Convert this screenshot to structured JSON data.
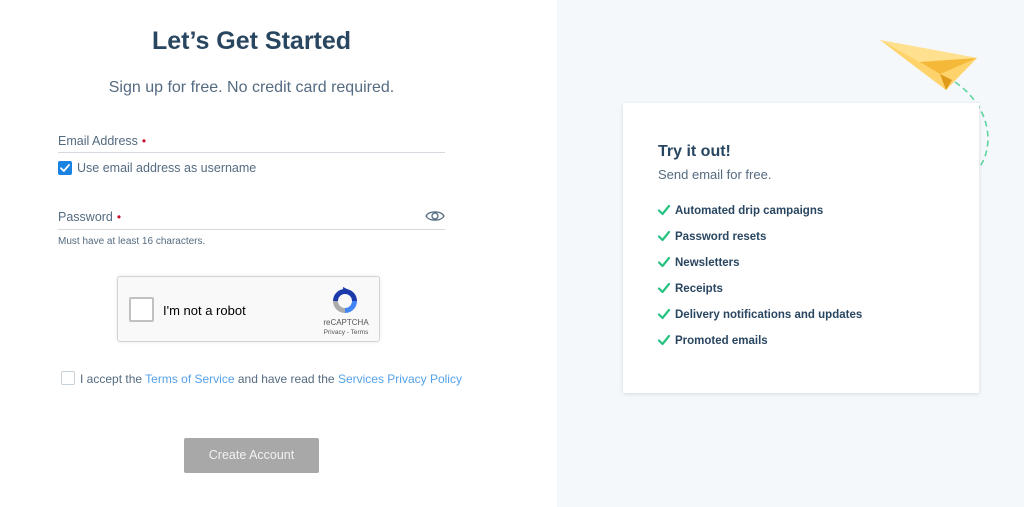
{
  "signup": {
    "title": "Let’s Get Started",
    "subtitle": "Sign up for free. No credit card required.",
    "email_label": "Email Address",
    "required_marker": "•",
    "use_email_checkbox_label": "Use email address as username",
    "use_email_checked": true,
    "password_label": "Password",
    "password_hint": "Must have at least 16 characters.",
    "terms_prefix": "I accept the ",
    "terms_link": "Terms of Service",
    "terms_middle": " and have read the ",
    "privacy_link": "Services Privacy Policy",
    "create_button": "Create Account"
  },
  "captcha": {
    "label": "I'm not a robot",
    "brand": "reCAPTCHA",
    "links": "Privacy - Terms"
  },
  "promo": {
    "title": "Try it out!",
    "subtitle": "Send email for free.",
    "features": [
      "Automated drip campaigns",
      "Password resets",
      "Newsletters",
      "Receipts",
      "Delivery notifications and updates",
      "Promoted emails"
    ]
  },
  "colors": {
    "accent": "#1a82e2",
    "check_green": "#26c281",
    "heading": "#294661",
    "button_disabled": "#a8a8a8"
  },
  "icons": [
    "eye-icon",
    "recaptcha-icon",
    "checkmark-icon",
    "paper-plane-icon"
  ]
}
